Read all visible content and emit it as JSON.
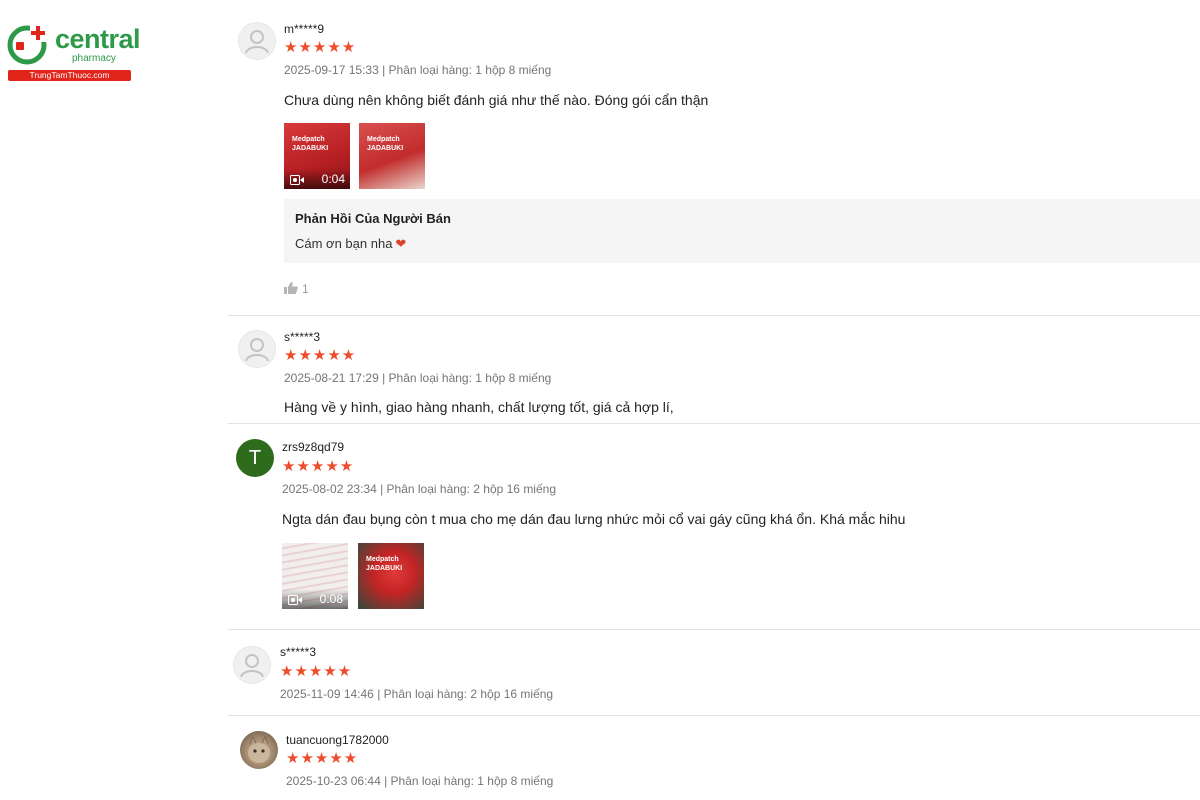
{
  "brand": {
    "name": "central",
    "sub": "pharmacy",
    "site": "TrungTamThuoc.com",
    "green": "#2e9a48",
    "red": "#e1251b"
  },
  "star_color": "#ee4d2d",
  "reviews": [
    {
      "username": "m*****9",
      "stars": "★★★★★",
      "rating": 5,
      "meta": "2025-09-17 15:33 | Phân loại hàng: 1 hộp 8 miếng",
      "comment": "Chưa dùng nên không biết đánh giá như thế nào. Đóng gói cẩn thận",
      "media": [
        {
          "type": "video",
          "duration": "0:04",
          "caption": "Medpatch JADABUKI"
        },
        {
          "type": "image",
          "caption": "Medpatch JADABUKI"
        }
      ],
      "seller_reply": {
        "title": "Phản Hồi Của Người Bán",
        "text": "Cám ơn bạn nha",
        "icon": "heart-icon"
      },
      "likes": "1"
    },
    {
      "username": "s*****3",
      "stars": "★★★★★",
      "rating": 5,
      "meta": "2025-08-21 17:29 | Phân loại hàng: 1 hộp 8 miếng",
      "comment": "Hàng về y hình, giao hàng nhanh, chất lượng tốt, giá cả hợp lí,"
    },
    {
      "username": "zrs9z8qd79",
      "avatar_letter": "T",
      "stars": "★★★★★",
      "rating": 5,
      "meta": "2025-08-02 23:34 | Phân loại hàng: 2 hộp 16 miếng",
      "comment": "Ngta dán đau bụng còn t mua cho mẹ dán đau lưng nhức mỏi cổ vai gáy cũng khá ổn. Khá mắc hihu",
      "media": [
        {
          "type": "video",
          "duration": "0:08"
        },
        {
          "type": "image",
          "caption": "Medpatch JADABUKI"
        }
      ]
    },
    {
      "username": "s*****3",
      "stars": "★★★★★",
      "rating": 5,
      "meta": "2025-11-09 14:46 | Phân loại hàng: 2 hộp 16 miếng"
    },
    {
      "username": "tuancuong1782000",
      "stars": "★★★★★",
      "rating": 5,
      "meta": "2025-10-23 06:44 | Phân loại hàng: 1 hộp 8 miếng"
    }
  ]
}
